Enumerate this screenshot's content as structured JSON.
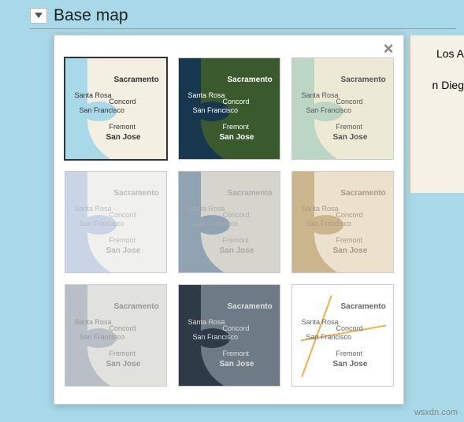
{
  "header": {
    "title": "Base map"
  },
  "background_labels": {
    "la": "Los A",
    "sd": "n Dieg"
  },
  "thumb_labels": {
    "sacramento": "Sacramento",
    "santarosa": "Santa Rosa",
    "concord": "Concord",
    "sanfran": "San\nFrancisco",
    "fremont": "Fremont",
    "sanjose": "San Jose"
  },
  "styles": [
    {
      "id": "default",
      "selected": true,
      "water": "#a8d9e8",
      "land": "#f3efe2",
      "text": "#333",
      "faded": false
    },
    {
      "id": "satellite",
      "selected": false,
      "water": "#17374f",
      "land": "#3a5a2e",
      "text": "#fff",
      "faded": false
    },
    {
      "id": "terrain",
      "selected": false,
      "water": "#bcd6c6",
      "land": "#ece9d4",
      "text": "#555",
      "faded": false
    },
    {
      "id": "light",
      "selected": false,
      "water": "#c9d4e6",
      "land": "#f7f5f0",
      "text": "#bbb",
      "faded": true
    },
    {
      "id": "silver",
      "selected": false,
      "water": "#8fa3b3",
      "land": "#e2ded2",
      "text": "#aaa",
      "faded": true
    },
    {
      "id": "retro",
      "selected": false,
      "water": "#cbb58d",
      "land": "#f2e9d8",
      "text": "#a98",
      "faded": true
    },
    {
      "id": "gray",
      "selected": false,
      "water": "#b8bfc6",
      "land": "#e8e6e1",
      "text": "#999",
      "faded": true
    },
    {
      "id": "dark",
      "selected": false,
      "water": "#2f3a47",
      "land": "#6e7a85",
      "text": "#ddd",
      "faded": false
    },
    {
      "id": "roads",
      "selected": false,
      "water": "#ffffff",
      "land": "#ffffff",
      "text": "#666",
      "faded": false,
      "roads": "#f5b041"
    }
  ],
  "watermark": "wsxdn.com"
}
